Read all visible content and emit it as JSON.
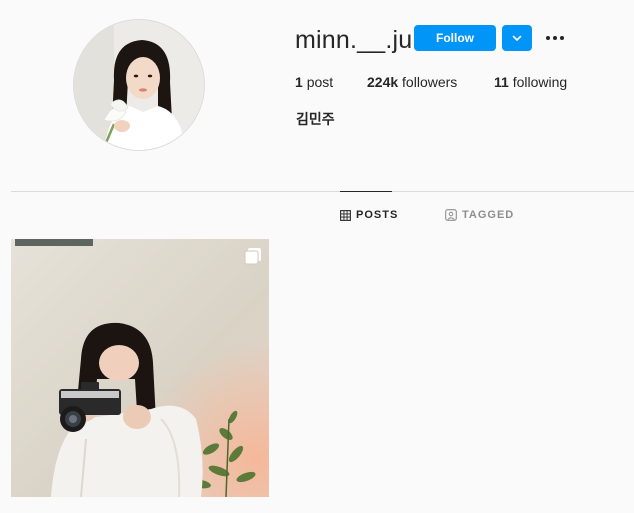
{
  "profile": {
    "username": "minn.__.ju",
    "follow_label": "Follow",
    "full_name": "김민주",
    "stats": {
      "posts_count": "1",
      "posts_label": "post",
      "followers_count": "224k",
      "followers_label": "followers",
      "following_count": "11",
      "following_label": "following"
    }
  },
  "tabs": [
    {
      "label": "POSTS",
      "icon": "grid-icon",
      "active": true
    },
    {
      "label": "TAGGED",
      "icon": "tag-user-icon",
      "active": false
    }
  ],
  "posts": [
    {
      "type": "carousel",
      "icon": "multiple-images-icon"
    }
  ],
  "colors": {
    "accent": "#0095f6",
    "background": "#fafafa",
    "text": "#262626",
    "muted": "#8e8e8e",
    "divider": "#dbdbdb"
  }
}
